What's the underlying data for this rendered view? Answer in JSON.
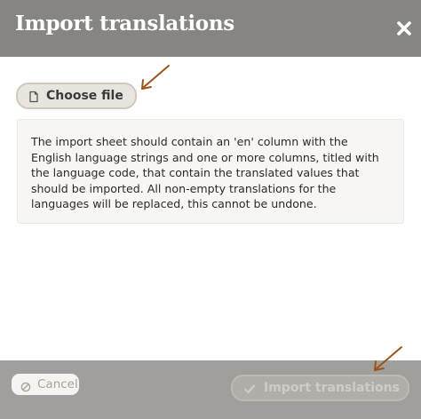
{
  "dialog": {
    "title": "Import translations",
    "close_icon": "close-icon"
  },
  "choose_file": {
    "label": "Choose file",
    "icon": "file-icon"
  },
  "info": {
    "text": "The import sheet should contain an 'en' column with the English language strings and one or more columns, titled with the language code, that contain the translated values that should be imported. All non-empty translations for the languages will be replaced, this cannot be undone."
  },
  "footer": {
    "cancel_label": "Cancel",
    "cancel_icon": "cancel-icon",
    "import_label": "Import translations",
    "import_icon": "check-icon"
  },
  "colors": {
    "header_bg": "#878582",
    "footer_bg": "#a19f9c",
    "annotation_arrow": "#9c5416"
  }
}
